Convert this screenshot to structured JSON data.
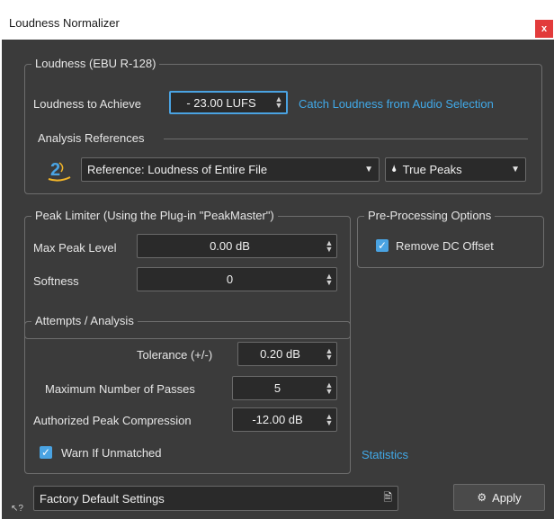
{
  "window": {
    "title": "Loudness Normalizer",
    "close_label": "x"
  },
  "loudness": {
    "legend": "Loudness (EBU R-128)",
    "achieve_label": "Loudness to Achieve",
    "achieve_value": "- 23.00 LUFS",
    "catch_link": "Catch Loudness from Audio Selection",
    "analysis_label": "Analysis References",
    "reference_value": "Reference: Loudness of Entire File",
    "peaks_value": "True Peaks"
  },
  "limiter": {
    "legend": "Peak Limiter (Using the Plug-in \"PeakMaster\")",
    "max_peak_label": "Max Peak Level",
    "max_peak_value": "0.00 dB",
    "softness_label": "Softness",
    "softness_value": "0"
  },
  "preprocessing": {
    "legend": "Pre-Processing Options",
    "remove_dc_label": "Remove DC Offset",
    "remove_dc_checked": true
  },
  "attempts": {
    "legend": "Attempts / Analysis",
    "tolerance_label": "Tolerance (+/-)",
    "tolerance_value": "0.20 dB",
    "passes_label": "Maximum Number of Passes",
    "passes_value": "5",
    "compression_label": "Authorized Peak Compression",
    "compression_value": "-12.00 dB",
    "warn_label": "Warn If Unmatched",
    "warn_checked": true
  },
  "statistics_link": "Statistics",
  "presets": {
    "value": "Factory Default Settings"
  },
  "apply_label": "Apply",
  "colors": {
    "accent": "#41a9e8",
    "close": "#e23b3b",
    "background": "#3b3b3b"
  }
}
